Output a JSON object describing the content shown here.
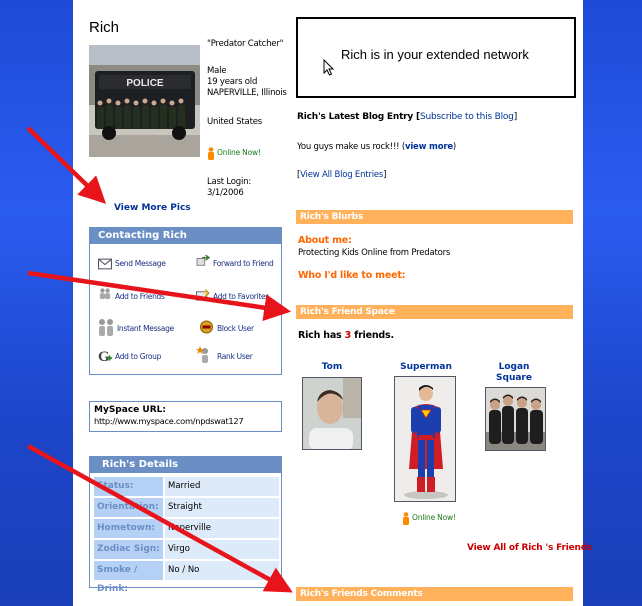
{
  "profile": {
    "name": "Rich",
    "headline": "\"Predator Catcher\"",
    "gender": "Male",
    "age": "19 years old",
    "city": "NAPERVILLE, Illinois",
    "country": "United States",
    "online": "Online Now!",
    "last_login_label": "Last Login:",
    "last_login_date": "3/1/2006",
    "photo_sign": "POLICE",
    "view_more_pics": "View More Pics"
  },
  "contact": {
    "title": "Contacting Rich",
    "items": [
      {
        "label": "Send Message",
        "icon": "envelope-icon"
      },
      {
        "label": "Forward to Friend",
        "icon": "forward-icon"
      },
      {
        "label": "Add to Friends",
        "icon": "add-friend-icon"
      },
      {
        "label": "Add to Favorites",
        "icon": "favorites-icon"
      },
      {
        "label": "Instant Message",
        "icon": "instant-message-icon"
      },
      {
        "label": "Block User",
        "icon": "block-icon"
      },
      {
        "label": "Add to Group",
        "icon": "group-icon"
      },
      {
        "label": "Rank User",
        "icon": "rank-icon"
      }
    ]
  },
  "url": {
    "label": "MySpace URL:",
    "value": "http://www.myspace.com/npdswat127"
  },
  "details": {
    "title": "Rich's Details",
    "rows": [
      {
        "key": "Status:",
        "value": "Married"
      },
      {
        "key": "Orientation:",
        "value": "Straight"
      },
      {
        "key": "Hometown:",
        "value": "Naperville"
      },
      {
        "key": "Zodiac Sign:",
        "value": "Virgo"
      },
      {
        "key": "Smoke / Drink:",
        "value": "No / No"
      }
    ]
  },
  "network": {
    "text": "Rich is in your extended network"
  },
  "blog": {
    "latest_label": "Rich's Latest Blog Entry [",
    "subscribe": "Subscribe to this Blog",
    "close_bracket": "]",
    "entry": "You guys make us rock!!! (",
    "view_more": "view more",
    "entry_close": ")",
    "view_all_open": "[",
    "view_all": "View All Blog Entries",
    "view_all_close": "]"
  },
  "blurbs": {
    "title": "Rich's Blurbs",
    "about_label": "About me:",
    "about_text": "Protecting Kids Online from Predators",
    "meet_label": "Who I'd like to meet:"
  },
  "friends": {
    "title": "Rich's Friend Space",
    "count_prefix": "Rich has ",
    "count": "3",
    "count_suffix": " friends.",
    "list": [
      {
        "name": "Tom"
      },
      {
        "name": "Superman",
        "status": "Online Now!"
      },
      {
        "name": "Logan Square"
      }
    ],
    "view_all": "View All of Rich 's Friends"
  },
  "comments": {
    "title": "Rich's Friends Comments"
  },
  "colors": {
    "arrow": "#e8141b",
    "accent_orange": "#ffb15c",
    "contact_blue": "#6b8fc5"
  }
}
